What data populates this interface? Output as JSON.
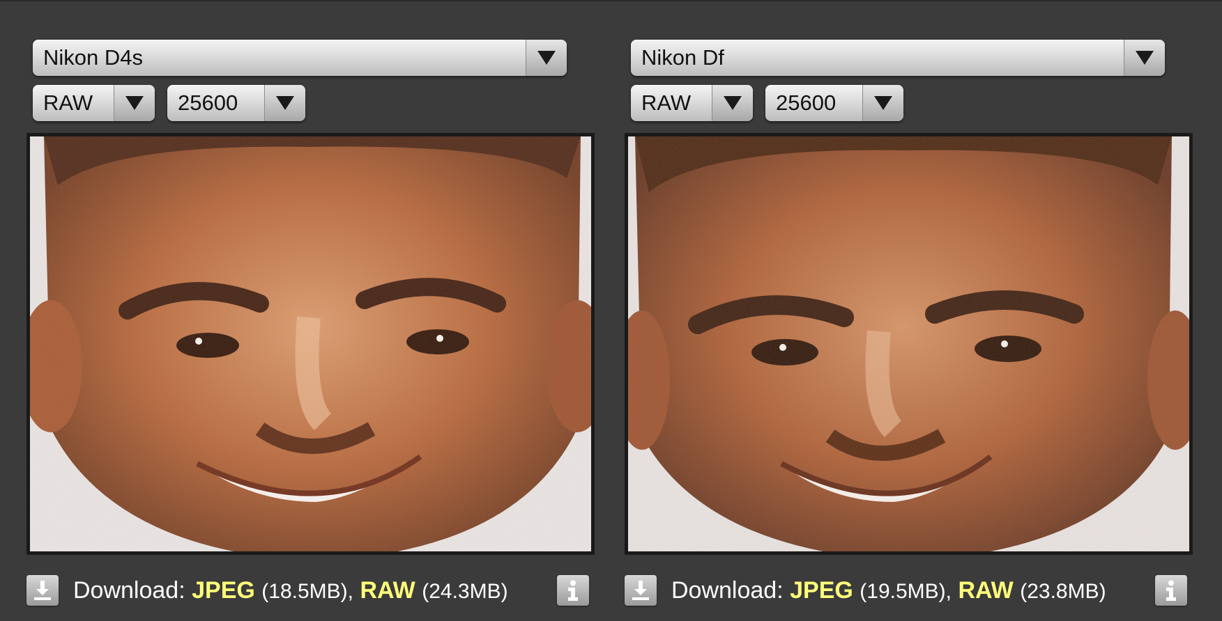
{
  "comparison": [
    {
      "camera": "Nikon D4s",
      "format": "RAW",
      "iso": "25600",
      "download": {
        "label": "Download:",
        "jpeg_label": "JPEG",
        "jpeg_size": "(18.5MB),",
        "raw_label": "RAW",
        "raw_size": "(24.3MB)"
      }
    },
    {
      "camera": "Nikon Df",
      "format": "RAW",
      "iso": "25600",
      "download": {
        "label": "Download:",
        "jpeg_label": "JPEG",
        "jpeg_size": "(19.5MB),",
        "raw_label": "RAW",
        "raw_size": "(23.8MB)"
      }
    }
  ],
  "icons": {
    "download": "download-icon",
    "info": "info-icon",
    "dropdown": "chevron-down-icon"
  },
  "colors": {
    "background": "#3b3b3b",
    "format_highlight": "#ffff7a",
    "text": "#ffffff"
  }
}
